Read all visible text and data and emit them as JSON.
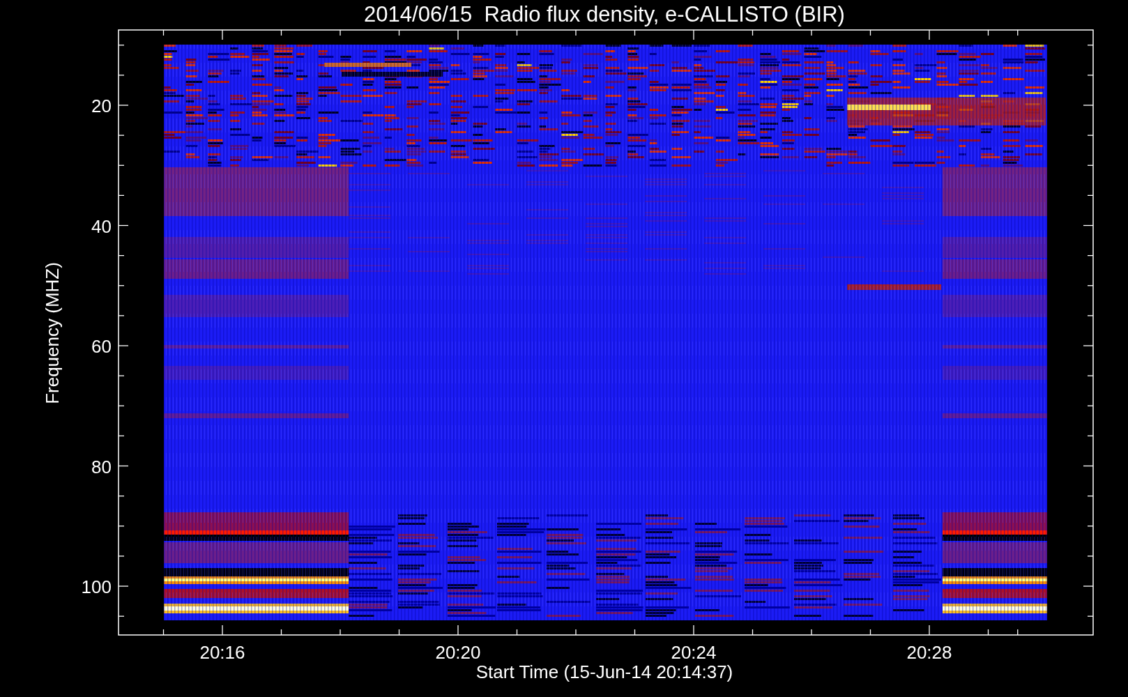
{
  "title": "2014/06/15  Radio flux density, e-CALLISTO (BIR)",
  "y_axis": {
    "label": "Frequency (MHZ)",
    "ticks": [
      "20",
      "40",
      "60",
      "80",
      "100"
    ]
  },
  "x_axis": {
    "label": "Start Time (15-Jun-14 20:14:37)",
    "ticks": [
      "20:16",
      "20:20",
      "20:24",
      "20:28"
    ]
  }
}
